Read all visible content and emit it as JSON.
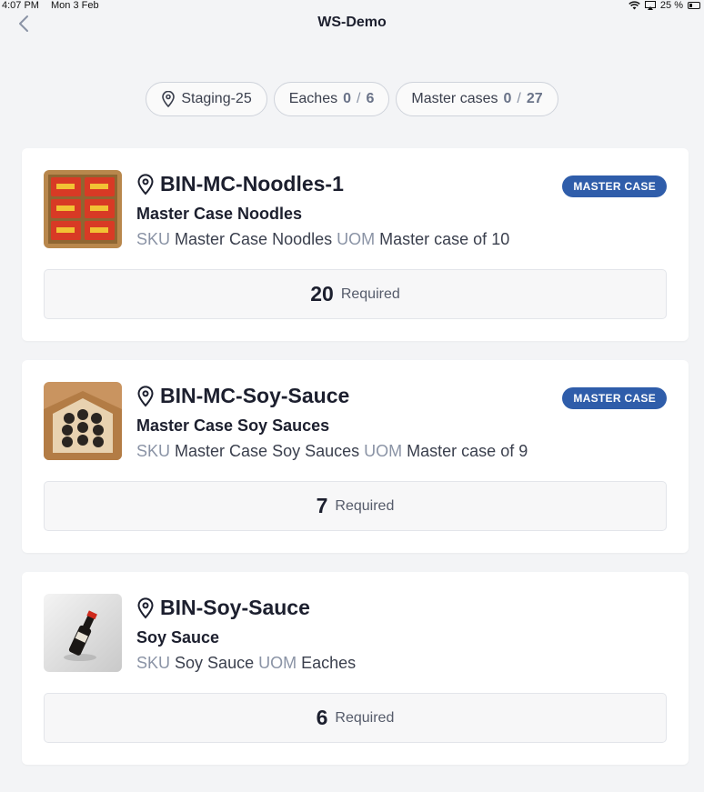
{
  "status_bar": {
    "time": "4:07 PM",
    "date": "Mon 3 Feb",
    "battery": "25 %"
  },
  "header": {
    "title": "WS-Demo"
  },
  "chips": {
    "location": "Staging-25",
    "eaches": {
      "label": "Eaches",
      "done": "0",
      "total": "6"
    },
    "master_cases": {
      "label": "Master cases",
      "done": "0",
      "total": "27"
    }
  },
  "labels": {
    "sku": "SKU",
    "uom": "UOM",
    "required": "Required"
  },
  "items": [
    {
      "bin": "BIN-MC-Noodles-1",
      "product": "Master Case Noodles",
      "sku": "Master Case Noodles",
      "uom": "Master case of 10",
      "badge": "MASTER CASE",
      "quantity": "20",
      "thumbnail": "noodles-box-image"
    },
    {
      "bin": "BIN-MC-Soy-Sauce",
      "product": "Master Case Soy Sauces",
      "sku": "Master Case Soy Sauces",
      "uom": "Master case of 9",
      "badge": "MASTER CASE",
      "quantity": "7",
      "thumbnail": "soy-sauce-case-image"
    },
    {
      "bin": "BIN-Soy-Sauce",
      "product": "Soy Sauce",
      "sku": "Soy Sauce",
      "uom": "Eaches",
      "quantity": "6",
      "thumbnail": "soy-sauce-bottle-image"
    }
  ],
  "colors": {
    "badge": "#2f5daa",
    "background": "#f3f4f6",
    "card": "#ffffff"
  }
}
